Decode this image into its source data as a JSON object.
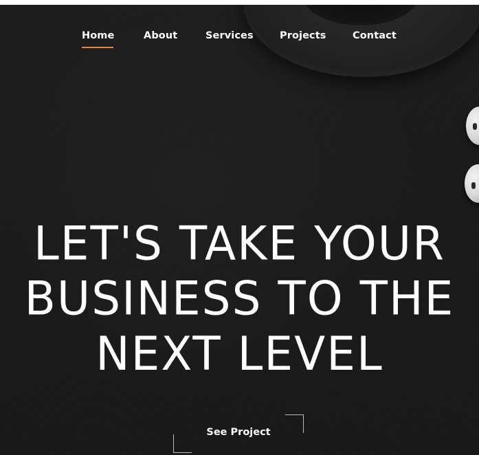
{
  "nav": {
    "items": [
      {
        "label": "Home",
        "active": true
      },
      {
        "label": "About"
      },
      {
        "label": "Services"
      },
      {
        "label": "Projects"
      },
      {
        "label": "Contact"
      }
    ]
  },
  "hero": {
    "headline_lines": [
      "LET'S TAKE YOUR",
      "BUSINESS TO THE",
      "NEXT LEVEL"
    ],
    "cta_label": "See Project"
  },
  "colors": {
    "background": "#1b1b1b",
    "text": "#ffffff",
    "accent": "#e5893a",
    "cta_corner": "#bdbdbd"
  },
  "icons": {
    "decorative_top_right": "coffee-cup-image",
    "decorative_right": "earbuds-image"
  }
}
